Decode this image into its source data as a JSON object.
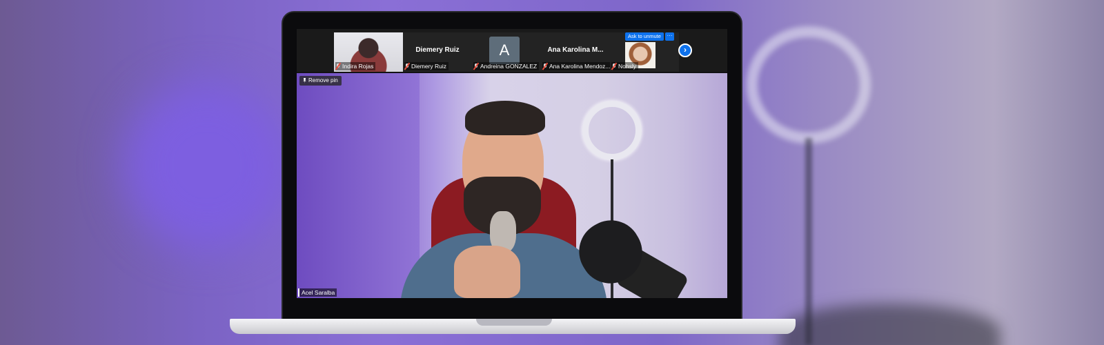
{
  "participants": [
    {
      "name": "Indira Rojas",
      "muted": true,
      "video": true
    },
    {
      "title": "Diemery Ruiz",
      "name": "Diemery Ruiz",
      "muted": true,
      "video": false
    },
    {
      "avatar_letter": "A",
      "name": "Andreina GONZALEZ",
      "muted": true,
      "video": false
    },
    {
      "title": "Ana Karolina M...",
      "name": "Ana Karolina Mendoz...",
      "muted": true,
      "video": false
    },
    {
      "name": "Nohsly",
      "muted": true,
      "video": true,
      "ask_to_unmute_label": "Ask to unmute",
      "more_label": "···"
    }
  ],
  "strip": {
    "next_label": "›"
  },
  "main_video": {
    "remove_pin_label": "Remove pin",
    "speaker_name": "Acel Saralba"
  },
  "colors": {
    "accent": "#0e72ed",
    "muted_mic": "#e74c3c"
  }
}
